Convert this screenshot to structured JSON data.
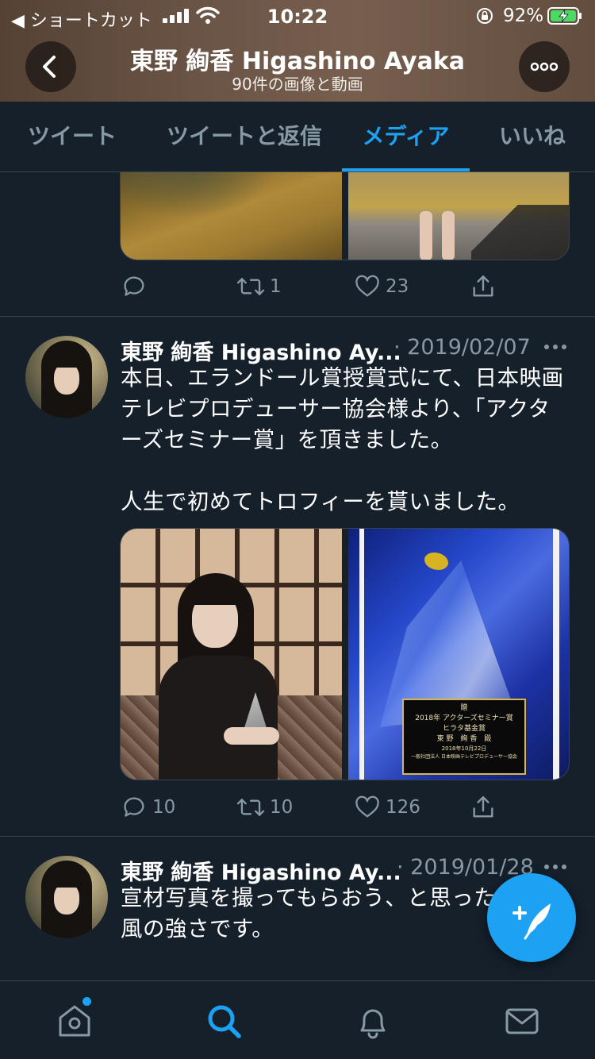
{
  "status_bar": {
    "back_app_label": "◀ ショートカット",
    "time": "10:22",
    "battery": "92%"
  },
  "header": {
    "title": "東野 絢香 Higashino Ayaka",
    "subtitle": "90件の画像と動画"
  },
  "tabs": [
    {
      "label": "ツイート",
      "active": false
    },
    {
      "label": "ツイートと返信",
      "active": false
    },
    {
      "label": "メディア",
      "active": true
    },
    {
      "label": "いいね",
      "active": false
    }
  ],
  "tweets": [
    {
      "partial": true,
      "replies": "",
      "retweets": "1",
      "likes": "23"
    },
    {
      "name": "東野 絢香 Higashino Ay...",
      "date": "· 2019/02/07",
      "text_lines": [
        "本日、エランドール賞授賞式にて、日本映画",
        "テレビプロデューサー協会様より、「アクタ",
        "ーズセミナー賞」を頂きました。",
        "",
        "人生で初めてトロフィーを貰いました。"
      ],
      "plaque_lines": [
        "贈",
        "2018年 アクターズセミナー賞",
        "ヒラタ基金賞",
        "東 野　絢 香　殿",
        "2018年10月22日",
        "一般社団法人 日本映画テレビプロデューサー協会"
      ],
      "replies": "10",
      "retweets": "10",
      "likes": "126"
    },
    {
      "name": "東野 絢香 Higashino Ay...",
      "date": "· 2019/01/28",
      "text_lines": [
        "宣材写真を撮ってもらおう、と思ったら",
        "風の強さです。"
      ]
    }
  ],
  "colors": {
    "background": "#15202b",
    "accent": "#1da1f2",
    "muted": "#8899a6",
    "border": "#38444d"
  },
  "icons": {
    "reply": "reply-icon",
    "retweet": "retweet-icon",
    "like": "heart-icon",
    "share": "share-icon",
    "home": "home-icon",
    "search": "search-icon",
    "notifications": "bell-icon",
    "messages": "envelope-icon",
    "compose": "compose-tweet-icon"
  }
}
